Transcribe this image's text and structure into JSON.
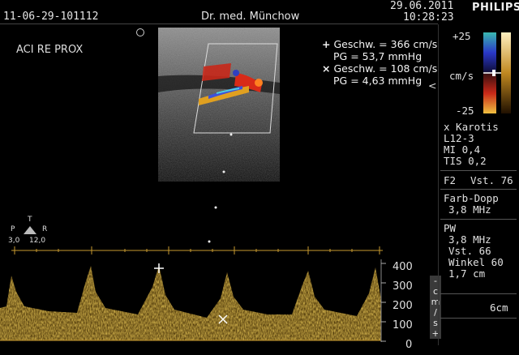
{
  "header": {
    "study_id": "11-06-29-101112",
    "physician": "Dr. med. Münchow",
    "date": "29.06.2011",
    "time": "10:28:23",
    "brand": "PHILIPS"
  },
  "image_label": "ACI RE PROX",
  "probe_orientation": {
    "top": "T",
    "left": "P",
    "right": "R",
    "left_value": "3,0",
    "right_value": "12,0"
  },
  "measurements": [
    {
      "marker": "+",
      "velocity": "Geschw. = 366 cm/s",
      "gradient": "PG = 53,7 mmHg"
    },
    {
      "marker": "×",
      "velocity": "Geschw. = 108 cm/s",
      "gradient": "PG = 4,63 mmHg"
    }
  ],
  "color_scale": {
    "max": "+25",
    "min": "-25",
    "unit": "cm/s",
    "arrow": "<"
  },
  "settings": {
    "preset": "x Karotis",
    "probe": "L12-3",
    "mi": "MI 0,4",
    "tis": "TIS 0,2",
    "frame": "F2",
    "gain": "Vst. 76",
    "color_mode": "Farb-Dopp",
    "color_freq": "3,8 MHz",
    "pw_mode": "PW",
    "pw_freq": "3,8 MHz",
    "pw_gain": "Vst. 66",
    "angle": "Winkel 60",
    "gate": "1,7 cm",
    "depth": "6cm"
  },
  "spectral_axis": {
    "ticks": [
      "400",
      "300",
      "200",
      "100",
      "0"
    ],
    "unit_chars": [
      "-",
      "c",
      "m",
      "/",
      "s",
      "+"
    ]
  },
  "colors": {
    "doppler_gold": "#d9a51c",
    "flow_red": "#d82a18",
    "flow_blue": "#3d52d8",
    "text": "#e6e6e6"
  }
}
